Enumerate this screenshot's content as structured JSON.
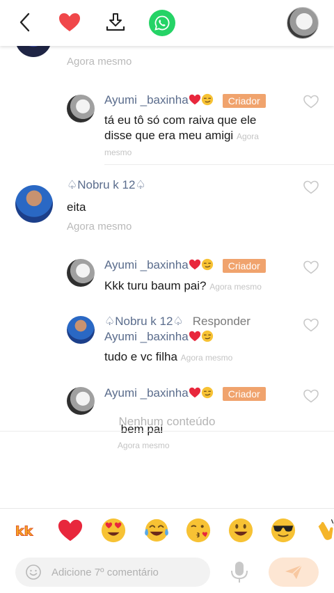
{
  "header": {
    "back_icon": "chevron-left-icon",
    "like_icon": "heart-icon",
    "download_icon": "download-icon",
    "share_icon": "whatsapp-icon",
    "accent_color": "#f0a36d"
  },
  "comments": {
    "top_partial_time": "Agora mesmo",
    "reply1": {
      "name": "Ayumi _baxinha",
      "badge": "Criador",
      "text": "tá  eu tô só com raiva que ele disse que era meu amigi",
      "time": "Agora mesmo"
    },
    "comment2": {
      "name": "♤Nobru k 12♤",
      "text": "eita",
      "time": "Agora mesmo"
    },
    "reply2": {
      "name": "Ayumi _baxinha",
      "badge": "Criador",
      "text": "Kkk turu baum  pai?",
      "time": "Agora mesmo"
    },
    "reply3": {
      "name": "♤Nobru k 12♤",
      "action": "Responder",
      "reply_to": "Ayumi _baxinha",
      "text": "tudo e vc filha",
      "time": "Agora mesmo"
    },
    "reply4": {
      "name": "Ayumi _baxinha",
      "badge": "Criador",
      "text": " bem pai",
      "time": "Agora mesmo"
    }
  },
  "empty_text": "Nenhum conteúdo",
  "emoji_bar": {
    "items": [
      "kkk-sticker",
      "red-heart",
      "heart-eyes",
      "tears-of-joy",
      "kissing-face",
      "smiley",
      "sunglasses",
      "clapping-hands"
    ]
  },
  "composer": {
    "placeholder": "Adicione 7º comentário",
    "send_color": "#fde6d3"
  }
}
